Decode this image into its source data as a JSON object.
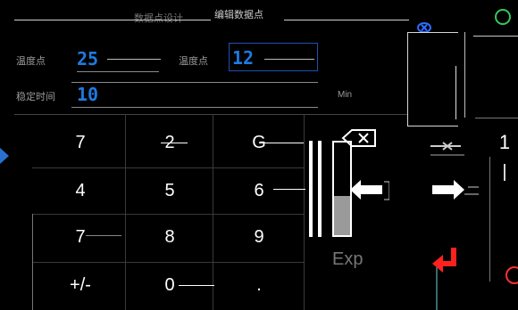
{
  "dialog": {
    "title": "编辑数据点",
    "title_left_fragment": "数据点设计"
  },
  "fields": {
    "temp1_label": "温度点",
    "temp1_value": "25",
    "temp2_label": "温度点",
    "temp2_value": "12",
    "time_label": "稳定时间",
    "time_value": "10",
    "unit_label": "Min"
  },
  "keypad": {
    "row1": [
      "7",
      "2",
      "G"
    ],
    "row2": [
      "4",
      "5",
      "6"
    ],
    "row3": [
      "7",
      "8",
      "9"
    ],
    "row4": [
      "+/-",
      "0",
      "."
    ],
    "exp_label": "Exp",
    "side_top": "1",
    "side_bar": "|"
  },
  "icons": {
    "close": "close-icon",
    "backspace": "backspace-icon",
    "left_arrow": "arrow-left-icon",
    "right_arrow": "arrow-right-icon",
    "enter": "enter-icon",
    "circle": "circle-icon"
  },
  "colors": {
    "accent_blue": "#1f7ae0",
    "enter_red": "#ff2020",
    "background": "#000000"
  }
}
